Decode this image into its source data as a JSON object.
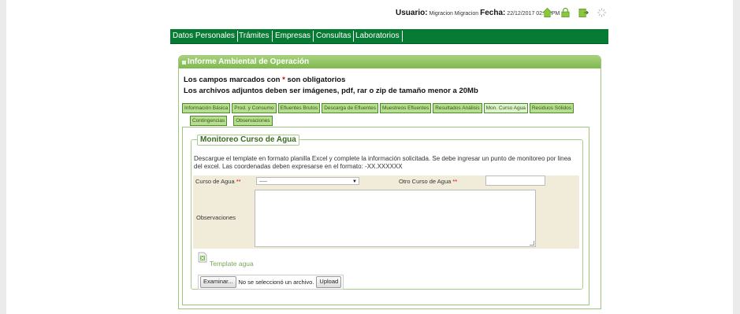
{
  "header": {
    "user_label": "Usuario:",
    "user_name": "Migracion Migracion",
    "date_label": "Fecha:",
    "date_value": "22/12/2017 02:12 PM",
    "icons": [
      "home-icon",
      "lock-icon",
      "exit-icon",
      "loading-icon"
    ]
  },
  "nav": {
    "items": [
      "Datos Personales",
      "Trámites",
      "Empresas",
      "Consultas",
      "Laboratorios"
    ]
  },
  "panel": {
    "title": "Informe Ambiental de Operación",
    "required_prefix": "Los campos marcados con ",
    "required_star": "*",
    "required_suffix": " son obligatorios",
    "attachments_note": "Los archivos adjuntos deben ser imágenes, pdf, rar o zip de tamaño menor a 20Mb"
  },
  "tabs": {
    "row1": [
      "Información Básica",
      "Prod. y Consumo",
      "Efluentes Brutos",
      "Descarga de Efluentes",
      "Muestreos Efluentes",
      "Resultados Análisis",
      "Mon. Curso Agua",
      "Residuos Sólidos"
    ],
    "row2": [
      "Contingencias",
      "Observaciones"
    ],
    "active": "Mon. Curso Agua"
  },
  "section": {
    "legend": "Monitoreo Curso de Agua",
    "description": "Descargue el template en formato planilla Excel y complete la información solicitada. Se debe ingresar un punto de monitoreo por linea del excel. Las coordenadas deben expresarse en el formato: -XX.XXXXXX",
    "curso_label": "Curso de Agua",
    "curso_value": "-----",
    "otro_label": "Otro Curso de Agua",
    "required_mark": "**",
    "obs_label": "Observaciones",
    "template_link": "Template agua",
    "browse_button": "Examinar...",
    "no_file": "No se seleccionó un archivo.",
    "upload_button": "Upload"
  }
}
